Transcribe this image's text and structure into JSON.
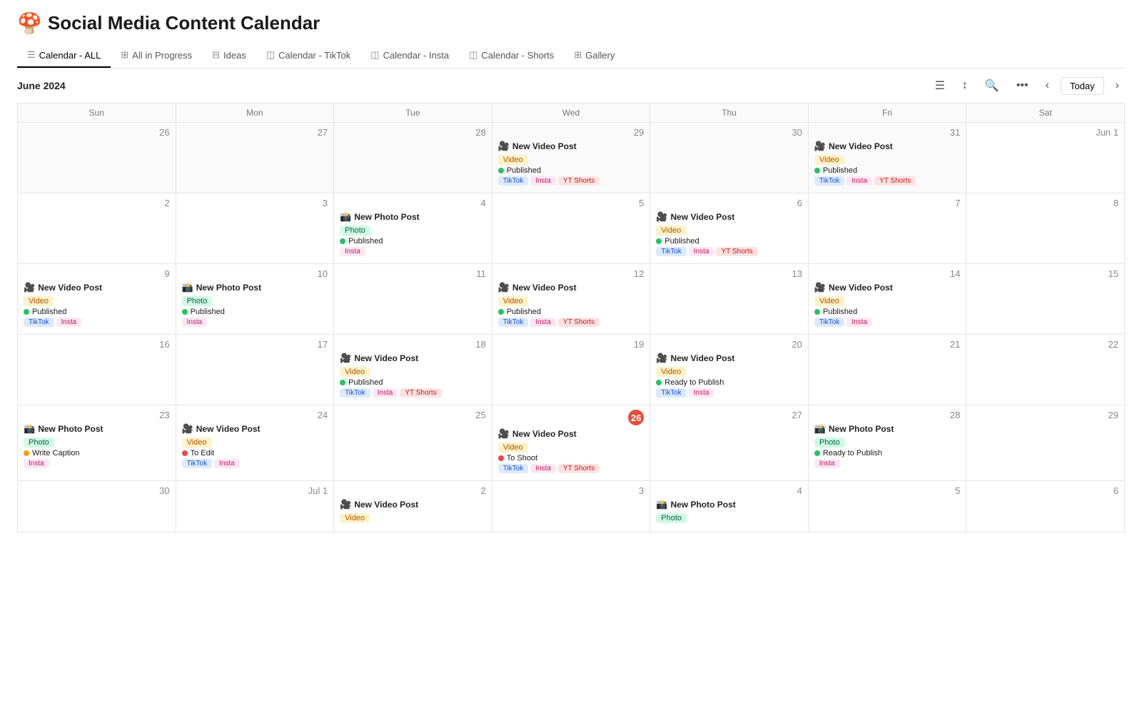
{
  "header": {
    "emoji": "🍄",
    "title": "Social Media Content Calendar"
  },
  "tabs": [
    {
      "id": "calendar-all",
      "label": "Calendar - ALL",
      "icon": "☰",
      "active": true
    },
    {
      "id": "all-in-progress",
      "label": "All in Progress",
      "icon": "⊞",
      "active": false
    },
    {
      "id": "ideas",
      "label": "Ideas",
      "icon": "⊟",
      "active": false
    },
    {
      "id": "calendar-tiktok",
      "label": "Calendar - TikTok",
      "icon": "◫",
      "active": false
    },
    {
      "id": "calendar-insta",
      "label": "Calendar - Insta",
      "icon": "◫",
      "active": false
    },
    {
      "id": "calendar-shorts",
      "label": "Calendar - Shorts",
      "icon": "◫",
      "active": false
    },
    {
      "id": "gallery",
      "label": "Gallery",
      "icon": "⊞",
      "active": false
    }
  ],
  "toolbar": {
    "month_label": "June 2024",
    "today_label": "Today"
  },
  "weekdays": [
    "Sun",
    "Mon",
    "Tue",
    "Wed",
    "Thu",
    "Fri",
    "Sat"
  ],
  "weeks": [
    {
      "days": [
        {
          "num": "26",
          "other": true,
          "events": []
        },
        {
          "num": "27",
          "other": true,
          "events": []
        },
        {
          "num": "28",
          "other": true,
          "events": []
        },
        {
          "num": "29",
          "other": true,
          "events": [
            {
              "emoji": "🎥",
              "title": "New Video Post",
              "type": "video",
              "status": "published",
              "status_label": "Published",
              "platforms": [
                "TikTok",
                "Insta",
                "YT Shorts"
              ]
            }
          ]
        },
        {
          "num": "30",
          "other": true,
          "events": []
        },
        {
          "num": "31",
          "other": true,
          "events": [
            {
              "emoji": "🎥",
              "title": "New Video Post",
              "type": "video",
              "status": "published",
              "status_label": "Published",
              "platforms": [
                "TikTok",
                "Insta",
                "YT Shorts"
              ]
            }
          ]
        },
        {
          "num": "Jun 1",
          "other": false,
          "events": []
        }
      ]
    },
    {
      "days": [
        {
          "num": "2",
          "other": false,
          "events": []
        },
        {
          "num": "3",
          "other": false,
          "events": []
        },
        {
          "num": "4",
          "other": false,
          "events": [
            {
              "emoji": "📸",
              "title": "New Photo Post",
              "type": "photo",
              "status": "published",
              "status_label": "Published",
              "platforms": [
                "Insta"
              ]
            }
          ]
        },
        {
          "num": "5",
          "other": false,
          "events": []
        },
        {
          "num": "6",
          "other": false,
          "events": [
            {
              "emoji": "🎥",
              "title": "New Video Post",
              "type": "video",
              "status": "published",
              "status_label": "Published",
              "platforms": [
                "TikTok",
                "Insta",
                "YT Shorts"
              ]
            }
          ]
        },
        {
          "num": "7",
          "other": false,
          "events": []
        },
        {
          "num": "8",
          "other": false,
          "events": []
        }
      ]
    },
    {
      "days": [
        {
          "num": "9",
          "other": false,
          "events": [
            {
              "emoji": "🎥",
              "title": "New Video Post",
              "type": "video",
              "status": "published",
              "status_label": "Published",
              "platforms": [
                "TikTok",
                "Insta"
              ]
            }
          ]
        },
        {
          "num": "10",
          "other": false,
          "events": [
            {
              "emoji": "📸",
              "title": "New Photo Post",
              "type": "photo",
              "status": "published",
              "status_label": "Published",
              "platforms": [
                "Insta"
              ]
            }
          ]
        },
        {
          "num": "11",
          "other": false,
          "events": []
        },
        {
          "num": "12",
          "other": false,
          "events": [
            {
              "emoji": "🎥",
              "title": "New Video Post",
              "type": "video",
              "status": "published",
              "status_label": "Published",
              "platforms": [
                "TikTok",
                "Insta",
                "YT Shorts"
              ]
            }
          ]
        },
        {
          "num": "13",
          "other": false,
          "events": []
        },
        {
          "num": "14",
          "other": false,
          "events": [
            {
              "emoji": "🎥",
              "title": "New Video Post",
              "type": "video",
              "status": "published",
              "status_label": "Published",
              "platforms": [
                "TikTok",
                "Insta"
              ]
            }
          ]
        },
        {
          "num": "15",
          "other": false,
          "events": []
        }
      ]
    },
    {
      "days": [
        {
          "num": "16",
          "other": false,
          "events": []
        },
        {
          "num": "17",
          "other": false,
          "events": []
        },
        {
          "num": "18",
          "other": false,
          "events": [
            {
              "emoji": "🎥",
              "title": "New Video Post",
              "type": "video",
              "status": "published",
              "status_label": "Published",
              "platforms": [
                "TikTok",
                "Insta",
                "YT Shorts"
              ]
            }
          ]
        },
        {
          "num": "19",
          "other": false,
          "events": []
        },
        {
          "num": "20",
          "other": false,
          "events": [
            {
              "emoji": "🎥",
              "title": "New Video Post",
              "type": "video",
              "status": "ready",
              "status_label": "Ready to Publish",
              "platforms": [
                "TikTok",
                "Insta"
              ]
            }
          ]
        },
        {
          "num": "21",
          "other": false,
          "events": []
        },
        {
          "num": "22",
          "other": false,
          "events": []
        }
      ]
    },
    {
      "days": [
        {
          "num": "23",
          "other": false,
          "events": [
            {
              "emoji": "📸",
              "title": "New Photo Post",
              "type": "photo",
              "status": "write",
              "status_label": "Write Caption",
              "platforms": [
                "Insta"
              ]
            }
          ]
        },
        {
          "num": "24",
          "other": false,
          "events": [
            {
              "emoji": "🎥",
              "title": "New Video Post",
              "type": "video",
              "status": "edit",
              "status_label": "To Edit",
              "platforms": [
                "TikTok",
                "Insta"
              ]
            }
          ]
        },
        {
          "num": "25",
          "other": false,
          "events": []
        },
        {
          "num": "26",
          "other": false,
          "today": true,
          "events": [
            {
              "emoji": "🎥",
              "title": "New Video Post",
              "type": "video",
              "status": "shoot",
              "status_label": "To Shoot",
              "platforms": [
                "TikTok",
                "Insta",
                "YT Shorts"
              ]
            }
          ]
        },
        {
          "num": "27",
          "other": false,
          "events": []
        },
        {
          "num": "28",
          "other": false,
          "events": [
            {
              "emoji": "📸",
              "title": "New Photo Post",
              "type": "photo",
              "status": "ready",
              "status_label": "Ready to Publish",
              "platforms": [
                "Insta"
              ]
            }
          ]
        },
        {
          "num": "29",
          "other": false,
          "events": []
        }
      ]
    },
    {
      "days": [
        {
          "num": "30",
          "other": false,
          "events": []
        },
        {
          "num": "Jul 1",
          "other": false,
          "events": []
        },
        {
          "num": "2",
          "other": false,
          "events": [
            {
              "emoji": "🎥",
              "title": "New Video Post",
              "type": "video",
              "status": "none",
              "status_label": "",
              "platforms": []
            }
          ]
        },
        {
          "num": "3",
          "other": false,
          "events": []
        },
        {
          "num": "4",
          "other": false,
          "events": [
            {
              "emoji": "📸",
              "title": "New Photo Post",
              "type": "photo",
              "status": "none",
              "status_label": "",
              "platforms": []
            }
          ]
        },
        {
          "num": "5",
          "other": false,
          "events": []
        },
        {
          "num": "6",
          "other": false,
          "events": []
        }
      ]
    }
  ]
}
